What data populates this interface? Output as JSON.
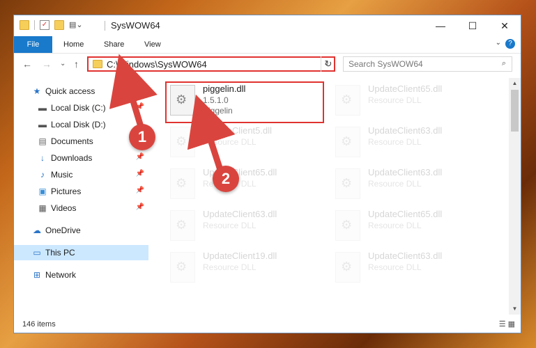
{
  "window": {
    "title": "SysWOW64"
  },
  "window_controls": {
    "minimize": "—",
    "maximize": "☐",
    "close": "✕"
  },
  "ribbon": {
    "tabs": [
      "File",
      "Home",
      "Share",
      "View"
    ],
    "help": "?",
    "expand": "⌄"
  },
  "nav": {
    "back": "←",
    "forward": "→",
    "recent": "⌄",
    "up": "↑"
  },
  "address": {
    "path": "C:\\Windows\\SysWOW64",
    "dropdown": "⌄",
    "refresh": "↻"
  },
  "search": {
    "placeholder": "Search SysWOW64",
    "icon": "⌕"
  },
  "sidebar": {
    "items": [
      {
        "label": "Quick access",
        "icon": "★",
        "pinned": false
      },
      {
        "label": "Local Disk (C:)",
        "icon": "▬",
        "pinned": true
      },
      {
        "label": "Local Disk (D:)",
        "icon": "▬",
        "pinned": false
      },
      {
        "label": "Documents",
        "icon": "▤",
        "pinned": false
      },
      {
        "label": "Downloads",
        "icon": "↓",
        "pinned": true
      },
      {
        "label": "Music",
        "icon": "♪",
        "pinned": true
      },
      {
        "label": "Pictures",
        "icon": "▣",
        "pinned": true
      },
      {
        "label": "Videos",
        "icon": "▦",
        "pinned": true
      },
      {
        "label": "OneDrive",
        "icon": "☁",
        "pinned": false
      },
      {
        "label": "This PC",
        "icon": "▭",
        "pinned": false
      },
      {
        "label": "Network",
        "icon": "⊞",
        "pinned": false
      }
    ],
    "pin_glyph": "📌"
  },
  "files": [
    {
      "name": "piggelin.dll",
      "line2": "1.5.1.0",
      "line3": "Piggelin"
    },
    {
      "name": "UpdateClient65.dll",
      "line2": "Resource DLL"
    },
    {
      "name": "UpdateClient5.dll",
      "line2": "Resource DLL"
    },
    {
      "name": "UpdateClient63.dll",
      "line2": "Resource DLL"
    },
    {
      "name": "UpdateClient65.dll",
      "line2": "Resource DLL"
    },
    {
      "name": "UpdateClient63.dll",
      "line2": "Resource DLL"
    },
    {
      "name": "UpdateClient63.dll",
      "line2": "Resource DLL"
    },
    {
      "name": "UpdateClient65.dll",
      "line2": "Resource DLL"
    },
    {
      "name": "UpdateClient19.dll",
      "line2": "Resource DLL"
    },
    {
      "name": "UpdateClient63.dll",
      "line2": "Resource DLL"
    }
  ],
  "status": {
    "count": "146 items"
  },
  "annotations": {
    "step1": "1",
    "step2": "2"
  },
  "colors": {
    "accent": "#1979ca",
    "highlight_border": "#e0322f",
    "badge": "#d9453e",
    "selected": "#cce8ff"
  }
}
